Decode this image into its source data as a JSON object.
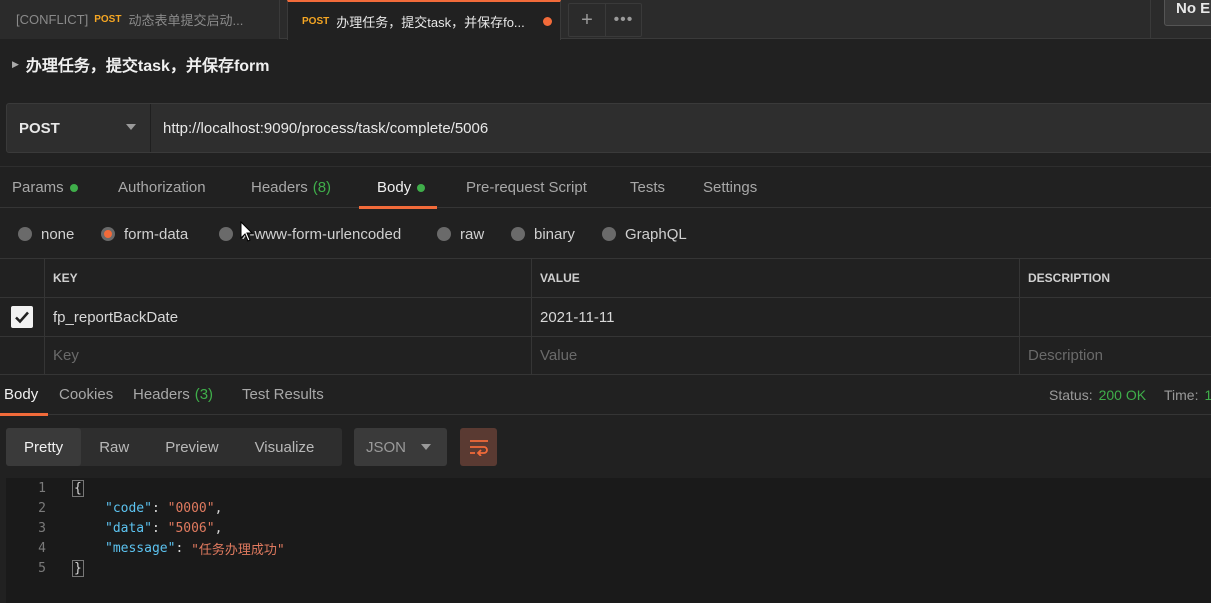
{
  "tabs": [
    {
      "tag": "[CONFLICT]",
      "method": "POST",
      "title": "动态表单提交启动..."
    },
    {
      "method": "POST",
      "title": "办理任务，提交task，并保存fo..."
    }
  ],
  "tab_actions": {
    "add": "+",
    "more": "•••"
  },
  "environment": {
    "label": "No E"
  },
  "request": {
    "title": "办理任务，提交task，并保存form",
    "method": "POST",
    "url": "http://localhost:9090/process/task/complete/5006"
  },
  "request_tabs": {
    "params": "Params",
    "authorization": "Authorization",
    "headers": "Headers",
    "headers_count": "(8)",
    "body": "Body",
    "prerequest": "Pre-request Script",
    "tests": "Tests",
    "settings": "Settings"
  },
  "body_types": {
    "none": "none",
    "form_data": "form-data",
    "urlencoded": "x-www-form-urlencoded",
    "raw": "raw",
    "binary": "binary",
    "graphql": "GraphQL"
  },
  "form_table": {
    "columns": [
      "KEY",
      "VALUE",
      "DESCRIPTION"
    ],
    "rows": [
      {
        "key": "fp_reportBackDate",
        "value": "2021-11-11",
        "description": ""
      }
    ],
    "placeholders": {
      "key": "Key",
      "value": "Value",
      "description": "Description"
    }
  },
  "response_tabs": {
    "body": "Body",
    "cookies": "Cookies",
    "headers": "Headers",
    "headers_count": "(3)",
    "test_results": "Test Results"
  },
  "response_status": {
    "status_label": "Status:",
    "status_value": "200 OK",
    "time_label": "Time:",
    "time_value": "1"
  },
  "view_tabs": {
    "pretty": "Pretty",
    "raw": "Raw",
    "preview": "Preview",
    "visualize": "Visualize"
  },
  "format": {
    "selected": "JSON"
  },
  "code": {
    "line_numbers": [
      "1",
      "2",
      "3",
      "4",
      "5"
    ],
    "open_brace": "{",
    "close_brace": "}",
    "fields": [
      {
        "key": "\"code\"",
        "value": "\"0000\"",
        "comma": ","
      },
      {
        "key": "\"data\"",
        "value": "\"5006\"",
        "comma": ","
      },
      {
        "key": "\"message\"",
        "value": "\"任务办理成功\"",
        "comma": ""
      }
    ]
  }
}
